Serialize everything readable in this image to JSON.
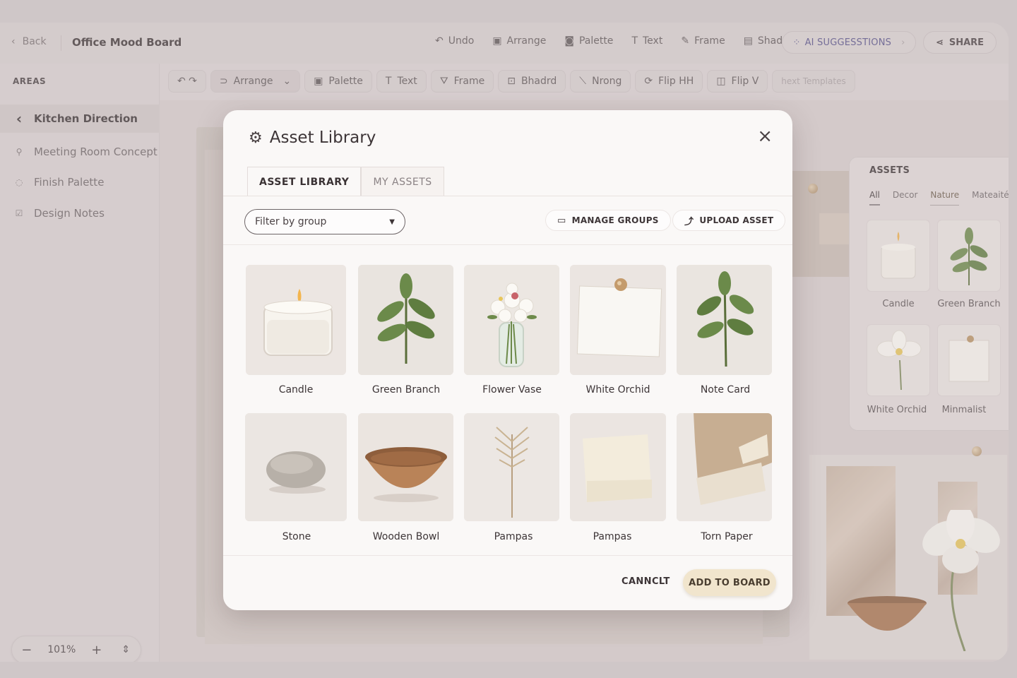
{
  "topbar": {
    "back_label": "Back",
    "board_title": "Office Mood Board",
    "actions": [
      {
        "icon": "undo-icon",
        "glyph": "↶",
        "label": "Undo"
      },
      {
        "icon": "arrange-icon",
        "glyph": "▣",
        "label": "Arrange"
      },
      {
        "icon": "palette-icon",
        "glyph": "◙",
        "label": "Palette"
      },
      {
        "icon": "text-icon",
        "glyph": "T",
        "label": "Text"
      },
      {
        "icon": "frame-icon",
        "glyph": "✎",
        "label": "Frame"
      },
      {
        "icon": "shadow-icon",
        "glyph": "▤",
        "label": "Shadow"
      }
    ],
    "ai_label": "AI SUGGESSTIONS",
    "share_label": "SHARE"
  },
  "sidebar": {
    "areas_label": "AREAS",
    "items": [
      {
        "label": "Kitchen Direction",
        "icon": "chevron-left-icon",
        "glyph": "‹"
      },
      {
        "label": "Meeting Room Concept",
        "icon": "pin-icon",
        "glyph": "⚲"
      },
      {
        "label": "Finish Palette",
        "icon": "palette-icon",
        "glyph": "◌"
      },
      {
        "label": "Design Notes",
        "icon": "note-icon",
        "glyph": "☑"
      }
    ],
    "zoom": {
      "minus": "−",
      "value": "101%",
      "plus": "+",
      "stepper": "⇕"
    }
  },
  "toolbar2": [
    {
      "label": "",
      "glyph": "↶ ↷",
      "icon": "undo-redo-icon"
    },
    {
      "label": "Arrange",
      "glyph": "⊃",
      "icon": "arrange-icon",
      "caret": "⌄"
    },
    {
      "label": "Palette",
      "glyph": "▣",
      "icon": "palette-icon"
    },
    {
      "label": "Text",
      "glyph": "T",
      "icon": "text-icon"
    },
    {
      "label": "Frame",
      "glyph": "⛛",
      "icon": "frame-icon"
    },
    {
      "label": "Bhadrd",
      "glyph": "⊡",
      "icon": "shadow-icon"
    },
    {
      "label": "Nrong",
      "glyph": "⟍",
      "icon": "wand-icon"
    },
    {
      "label": "Flip HH",
      "glyph": "⟳",
      "icon": "flip-h-icon"
    },
    {
      "label": "Flip V",
      "glyph": "◫",
      "icon": "flip-v-icon"
    },
    {
      "label": "hext Templates",
      "glyph": "",
      "icon": "",
      "ghost": true
    }
  ],
  "assets_panel": {
    "title": "ASSETS",
    "tabs": [
      "All",
      "Decor",
      "Nature",
      "Mateaités"
    ],
    "items": [
      "Candle",
      "Green Branch",
      "White Orchid",
      "Minmalist"
    ]
  },
  "modal": {
    "title": "Asset Library",
    "tabs": [
      "ASSET LIBRARY",
      "MY ASSETS"
    ],
    "filter_placeholder": "Filter by group",
    "manage_groups_label": "MANAGE GROUPS",
    "upload_label": "UPLOAD ASSET",
    "assets": [
      {
        "label": "Candle",
        "icon": "candle-icon"
      },
      {
        "label": "Green Branch",
        "icon": "branch-icon"
      },
      {
        "label": "Flower Vase",
        "icon": "vase-icon"
      },
      {
        "label": "White Orchid",
        "icon": "note-card-icon"
      },
      {
        "label": "Note Card",
        "icon": "branch-icon"
      },
      {
        "label": "Stone",
        "icon": "stone-icon"
      },
      {
        "label": "Wooden Bowl",
        "icon": "bowl-icon"
      },
      {
        "label": "Pampas",
        "icon": "pampas-icon"
      },
      {
        "label": "Pampas",
        "icon": "paper-icon"
      },
      {
        "label": "Torn Paper",
        "icon": "torn-paper-icon"
      }
    ],
    "cancel_label": "CANNCLT",
    "add_label": "ADD TO BOARD"
  },
  "colors": {
    "accent": "#f1e5cd",
    "background": "#ddd5d6",
    "modal": "#faf8f7"
  }
}
